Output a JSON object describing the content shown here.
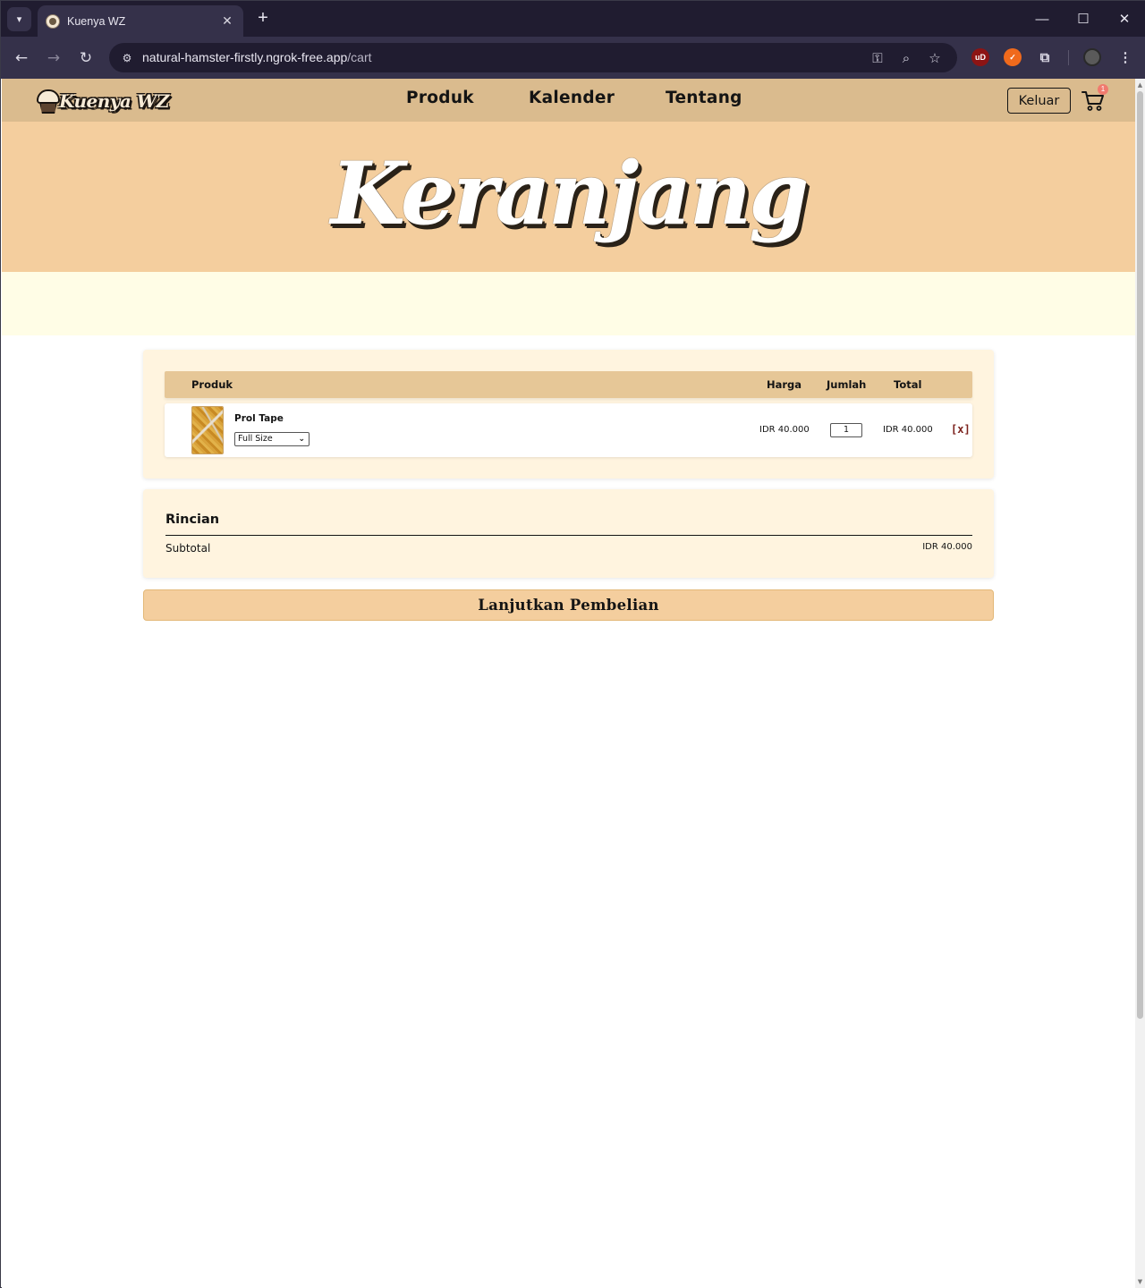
{
  "browser": {
    "tab_title": "Kuenya WZ",
    "url_host": "natural-hamster-firstly.ngrok-free.app",
    "url_path": "/cart",
    "minimize_glyph": "—",
    "maximize_glyph": "☐",
    "close_glyph": "✕",
    "new_tab_glyph": "+",
    "tab_close_glyph": "✕",
    "ext_ublock_label": "uD"
  },
  "site": {
    "logo_text": "Kuenya WZ",
    "nav": [
      {
        "label": "Produk"
      },
      {
        "label": "Kalender"
      },
      {
        "label": "Tentang"
      }
    ],
    "logout_label": "Keluar",
    "cart_count": "1"
  },
  "hero": {
    "title": "Keranjang"
  },
  "cart": {
    "headers": {
      "product": "Produk",
      "price": "Harga",
      "quantity": "Jumlah",
      "total": "Total"
    },
    "items": [
      {
        "name": "Prol Tape",
        "variant": "Full Size",
        "price": "IDR 40.000",
        "quantity": "1",
        "total": "IDR 40.000",
        "remove_label": "[x]"
      }
    ]
  },
  "summary": {
    "title": "Rincian",
    "subtotal_label": "Subtotal",
    "subtotal_value": "IDR 40.000"
  },
  "checkout": {
    "continue_label": "Lanjutkan Pembelian"
  },
  "colors": {
    "nav_bg": "#dabb8e",
    "hero_bg": "#f4ce9e",
    "hero_band": "#fffde6",
    "card_bg": "#fff4df",
    "table_head_bg": "#e6c797",
    "remove_color": "#7a1f1a",
    "badge_color": "#f07a6e"
  }
}
